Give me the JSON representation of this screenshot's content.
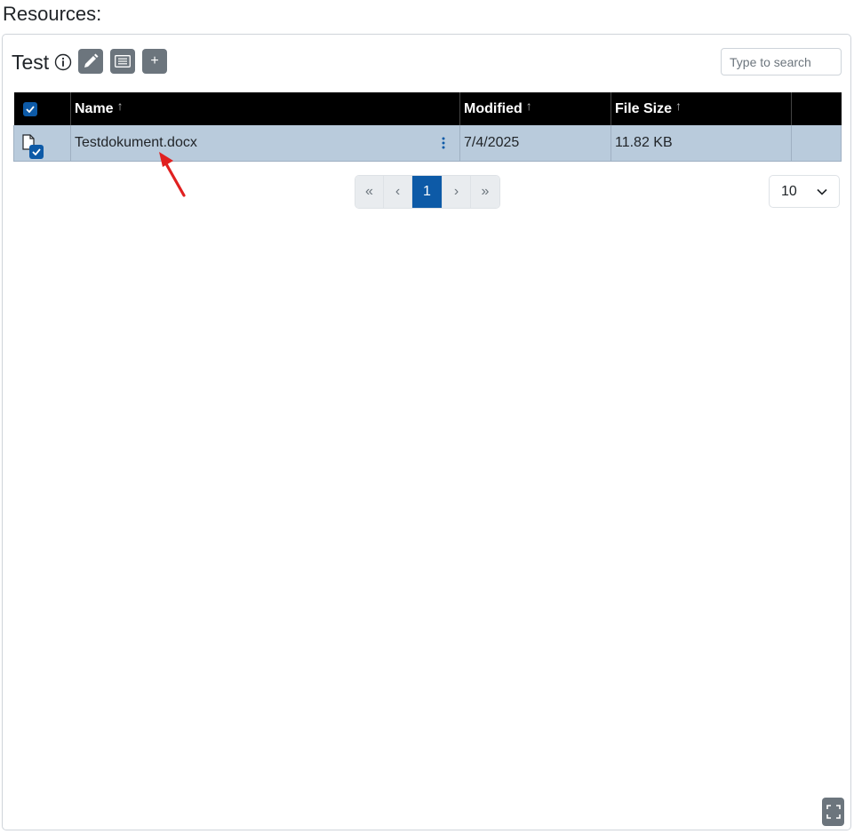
{
  "page": {
    "heading": "Resources:"
  },
  "panel": {
    "title": "Test",
    "search_placeholder": "Type to search",
    "add_label": "+"
  },
  "table": {
    "columns": [
      "Name",
      "Modified",
      "File Size"
    ],
    "sort_indicator": "↑",
    "rows": [
      {
        "name": "Testdokument.docx",
        "modified": "7/4/2025",
        "size": "11.82 KB",
        "selected": true
      }
    ]
  },
  "pagination": {
    "first": "«",
    "prev": "‹",
    "current": "1",
    "next": "›",
    "last": "»"
  },
  "page_size": {
    "value": "10"
  },
  "colors": {
    "accent": "#0d5aa7",
    "header_bg": "#000000",
    "selected_row": "#b9cbdc",
    "button_gray": "#6c757d",
    "annotation_arrow": "#e02020"
  },
  "icons": {
    "info": "info-icon",
    "edit": "pencil-icon",
    "list": "list-icon",
    "file": "file-icon",
    "menu": "kebab-menu-icon",
    "fullscreen": "fullscreen-icon"
  }
}
